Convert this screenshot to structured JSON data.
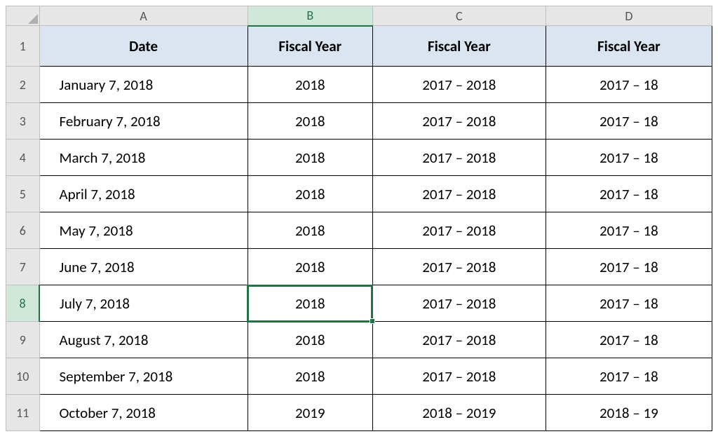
{
  "columns": [
    "A",
    "B",
    "C",
    "D"
  ],
  "headers": {
    "A": "Date",
    "B": "Fiscal Year",
    "C": "Fiscal Year",
    "D": "Fiscal Year"
  },
  "selection": {
    "active_cell": "B8",
    "active_col": "B",
    "active_row": "8"
  },
  "rows": [
    {
      "num": "2",
      "date": "January 7, 2018",
      "fy1": "2018",
      "fy2": "2017 – 2018",
      "fy3": "2017 – 18"
    },
    {
      "num": "3",
      "date": "February 7, 2018",
      "fy1": "2018",
      "fy2": "2017 – 2018",
      "fy3": "2017 – 18"
    },
    {
      "num": "4",
      "date": "March 7, 2018",
      "fy1": "2018",
      "fy2": "2017 – 2018",
      "fy3": "2017 – 18"
    },
    {
      "num": "5",
      "date": "April 7, 2018",
      "fy1": "2018",
      "fy2": "2017 – 2018",
      "fy3": "2017 – 18"
    },
    {
      "num": "6",
      "date": "May 7, 2018",
      "fy1": "2018",
      "fy2": "2017 – 2018",
      "fy3": "2017 – 18"
    },
    {
      "num": "7",
      "date": "June 7, 2018",
      "fy1": "2018",
      "fy2": "2017 – 2018",
      "fy3": "2017 – 18"
    },
    {
      "num": "8",
      "date": "July 7, 2018",
      "fy1": "2018",
      "fy2": "2017 – 2018",
      "fy3": "2017 – 18"
    },
    {
      "num": "9",
      "date": "August 7, 2018",
      "fy1": "2018",
      "fy2": "2017 – 2018",
      "fy3": "2017 – 18"
    },
    {
      "num": "10",
      "date": "September 7, 2018",
      "fy1": "2018",
      "fy2": "2017 – 2018",
      "fy3": "2017 – 18"
    },
    {
      "num": "11",
      "date": "October 7, 2018",
      "fy1": "2019",
      "fy2": "2018 – 2019",
      "fy3": "2018 – 19"
    }
  ]
}
